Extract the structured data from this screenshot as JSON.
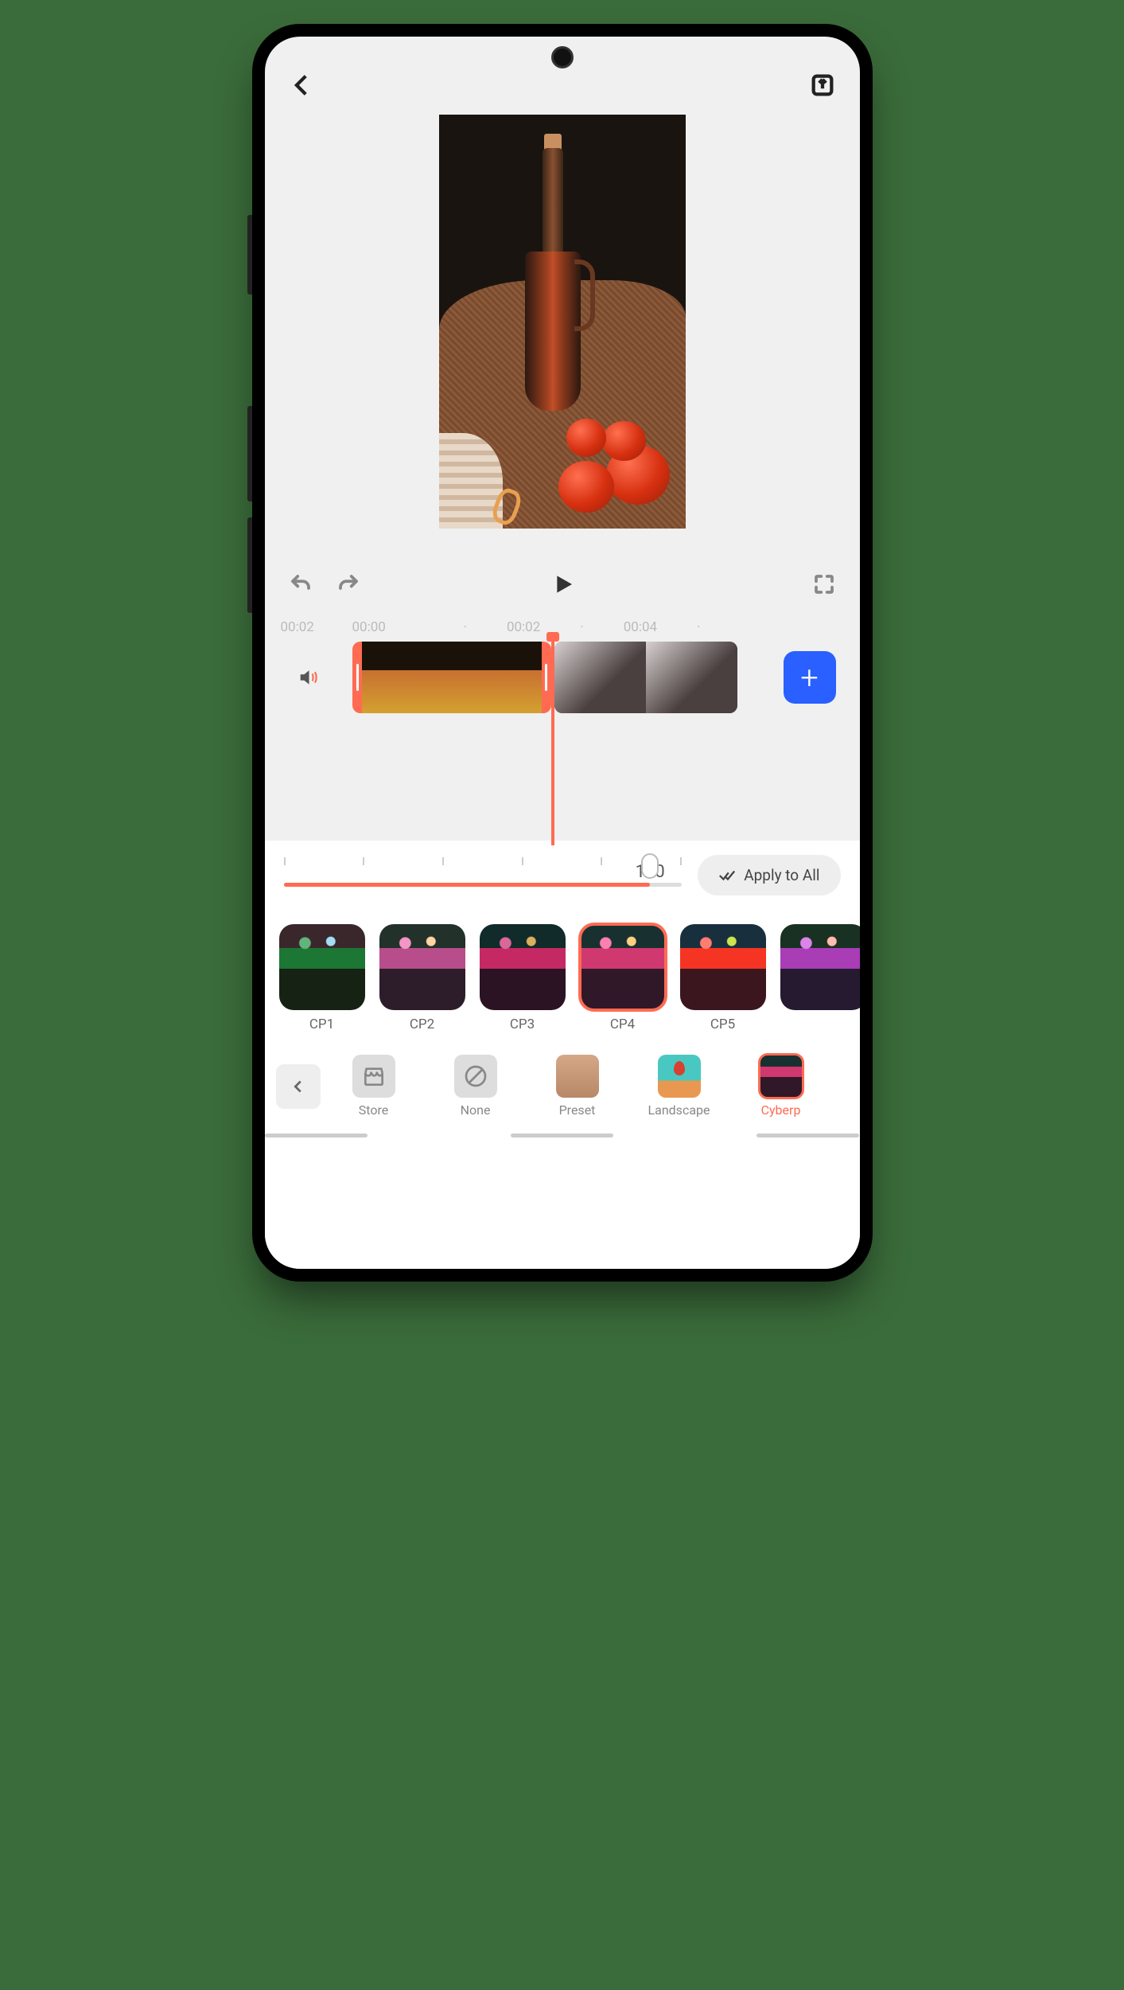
{
  "header": {
    "back_icon": "back",
    "export_icon": "export"
  },
  "controls": {
    "undo": "undo",
    "redo": "redo",
    "play": "play",
    "fullscreen": "fullscreen"
  },
  "timeline": {
    "current": "00:02",
    "marks": [
      "00:00",
      "·",
      "00:02",
      "·",
      "00:04",
      "·"
    ],
    "audio_icon": "speaker",
    "add": "+"
  },
  "slider": {
    "value": "100",
    "apply_label": "Apply to All"
  },
  "filters": [
    {
      "id": "cp1",
      "label": "CP1"
    },
    {
      "id": "cp2",
      "label": "CP2"
    },
    {
      "id": "cp3",
      "label": "CP3"
    },
    {
      "id": "cp4",
      "label": "CP4",
      "selected": true
    },
    {
      "id": "cp5",
      "label": "CP5"
    },
    {
      "id": "cp6",
      "label": ""
    }
  ],
  "categories": [
    {
      "id": "store",
      "label": "Store",
      "icon": "store"
    },
    {
      "id": "none",
      "label": "None",
      "icon": "none"
    },
    {
      "id": "preset",
      "label": "Preset",
      "icon": "preset"
    },
    {
      "id": "landscape",
      "label": "Landscape",
      "icon": "landscape"
    },
    {
      "id": "cyber",
      "label": "Cyberp",
      "icon": "cyber",
      "active": true
    }
  ]
}
